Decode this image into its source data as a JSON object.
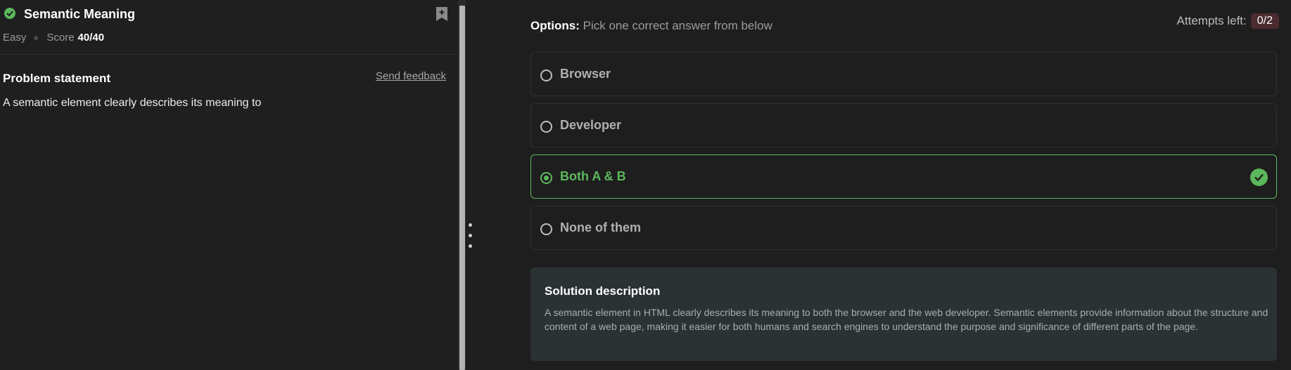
{
  "question": {
    "title": "Semantic Meaning",
    "difficulty": "Easy",
    "score_label": "Score",
    "score_value": "40/40",
    "status": "solved"
  },
  "problem": {
    "heading": "Problem statement",
    "feedback_link": "Send feedback",
    "statement": "A semantic element clearly describes its meaning to"
  },
  "options_header": {
    "label": "Options:",
    "instruction": "Pick one correct answer from below"
  },
  "attempts": {
    "label": "Attempts left:",
    "value": "0/2"
  },
  "options": [
    {
      "label": "Browser",
      "selected": false
    },
    {
      "label": "Developer",
      "selected": false
    },
    {
      "label": "Both A & B",
      "selected": true,
      "correct": true
    },
    {
      "label": "None of them",
      "selected": false
    }
  ],
  "solution": {
    "title": "Solution description",
    "text": "A semantic element in HTML clearly describes its meaning to both the browser and the web developer. Semantic elements provide information about the structure and content of a web page, making it easier for both humans and search engines to understand the purpose and significance of different parts of the page."
  },
  "icons": {
    "status": "check-circle-icon",
    "bookmark": "bookmark-add-icon",
    "correct": "check-circle-icon"
  },
  "colors": {
    "accent_green": "#5cb85c",
    "background": "#1e1e1e",
    "attempts_badge": "#4a2b2f",
    "solution_panel": "#2b3234"
  }
}
